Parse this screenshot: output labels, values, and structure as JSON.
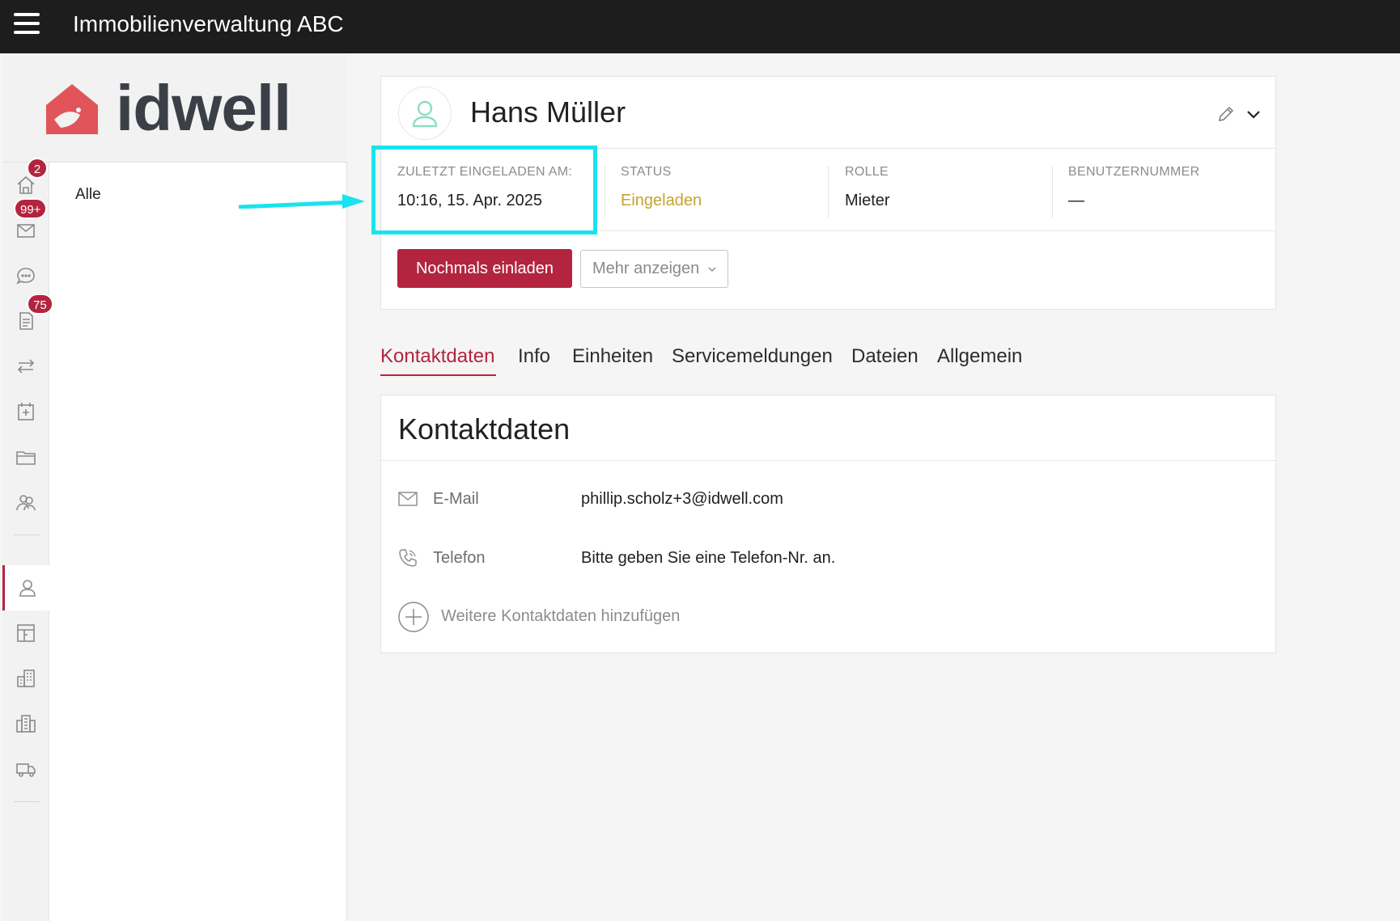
{
  "app": {
    "title": "Immobilienverwaltung ABC",
    "logo_text": "idwell"
  },
  "nav": {
    "badges": {
      "home": "2",
      "mail": "99+",
      "documents": "75"
    },
    "icons": [
      "home-icon",
      "mail-icon",
      "chat-icon",
      "document-icon",
      "transfer-icon",
      "calendar-icon",
      "folder-icon",
      "people-icon",
      "person-icon",
      "floorplan-icon",
      "building-icon",
      "buildings-icon",
      "truck-icon"
    ]
  },
  "filter": {
    "all_label": "Alle"
  },
  "profile": {
    "name": "Hans Müller",
    "invited_label": "ZULETZT EINGELADEN AM:",
    "invited_value": "10:16, 15. Apr. 2025",
    "status_label": "STATUS",
    "status_value": "Eingeladen",
    "role_label": "ROLLE",
    "role_value": "Mieter",
    "user_number_label": "BENUTZERNUMMER",
    "user_number_value": "—",
    "reinvite_button": "Nochmals einladen",
    "more_button": "Mehr anzeigen"
  },
  "tabs": [
    "Kontaktdaten",
    "Info",
    "Einheiten",
    "Servicemeldungen",
    "Dateien",
    "Allgemein"
  ],
  "contact": {
    "title": "Kontaktdaten",
    "email_label": "E-Mail",
    "email_value": "phillip.scholz+3@idwell.com",
    "phone_label": "Telefon",
    "phone_value": "Bitte geben Sie eine Telefon-Nr. an.",
    "add_label": "Weitere Kontaktdaten hinzufügen"
  },
  "colors": {
    "accent": "#b3243f",
    "status": "#c5a32c",
    "highlight": "#19e3ee",
    "topbar": "#1d1d1d"
  }
}
